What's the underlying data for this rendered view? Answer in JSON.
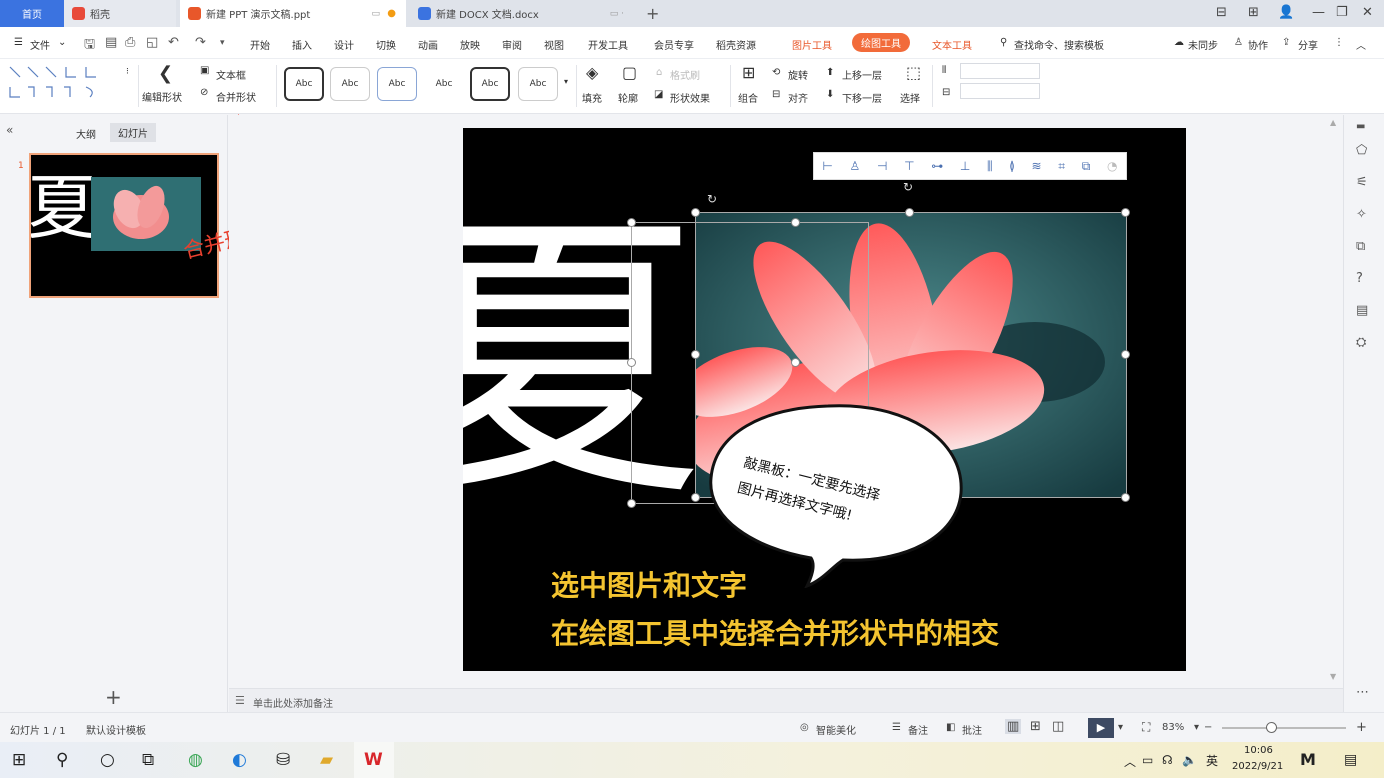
{
  "tabs": {
    "home": "首页",
    "wps": "稻壳",
    "ppt": "新建 PPT 演示文稿.ppt",
    "docx": "新建 DOCX 文档.docx",
    "add": "+"
  },
  "window": {
    "controls": [
      "⊟",
      "⊞",
      "👤",
      "—",
      "❐",
      "✕"
    ]
  },
  "menubar": {
    "file": "文件",
    "items": [
      "开始",
      "插入",
      "设计",
      "切换",
      "动画",
      "放映",
      "审阅",
      "视图",
      "开发工具",
      "会员专享",
      "稻壳资源"
    ],
    "picture_tools": "图片工具",
    "drawing_tools": "绘图工具",
    "text_tools": "文本工具",
    "search": "查找命令、搜索模板",
    "sync": "未同步",
    "collab": "协作",
    "share": "分享"
  },
  "ribbon": {
    "edit_shape": "编辑形状",
    "text_box": "文本框",
    "merge_shape": "合并形状",
    "style_label": "Abc",
    "fill": "填充",
    "outline": "轮廓",
    "format_brush": "格式刷",
    "shape_effects": "形状效果",
    "group": "组合",
    "rotate": "旋转",
    "align": "对齐",
    "bring_forward": "上移一层",
    "send_backward": "下移一层",
    "select": "选择"
  },
  "leftpanel": {
    "outline_tab": "大纲",
    "slides_tab": "幻灯片",
    "slide_number": "1",
    "add": "+"
  },
  "annotations": {
    "merge_hint": "合并形状在这里!"
  },
  "slide": {
    "big_char": "夏",
    "bubble_line1": "敲黑板：一定要先选择",
    "bubble_line2": "图片再选择文字哦!",
    "caption_line1": "选中图片和文字",
    "caption_line2": "在绘图工具中选择合并形状中的相交"
  },
  "notes": {
    "placeholder": "单击此处添加备注"
  },
  "status": {
    "slide_count": "幻灯片 1 / 1",
    "template": "默认设计模板",
    "beautify": "智能美化",
    "notes": "备注",
    "comments": "批注",
    "zoom": "83%"
  },
  "taskbar": {
    "lang": "英",
    "time": "10:06",
    "date": "2022/9/21"
  },
  "colors": {
    "accent_blue": "#3b73e0",
    "drawing_tools_orange": "#f26b3a",
    "caption_yellow": "#f4c430",
    "annotation_red": "#e8402e"
  }
}
